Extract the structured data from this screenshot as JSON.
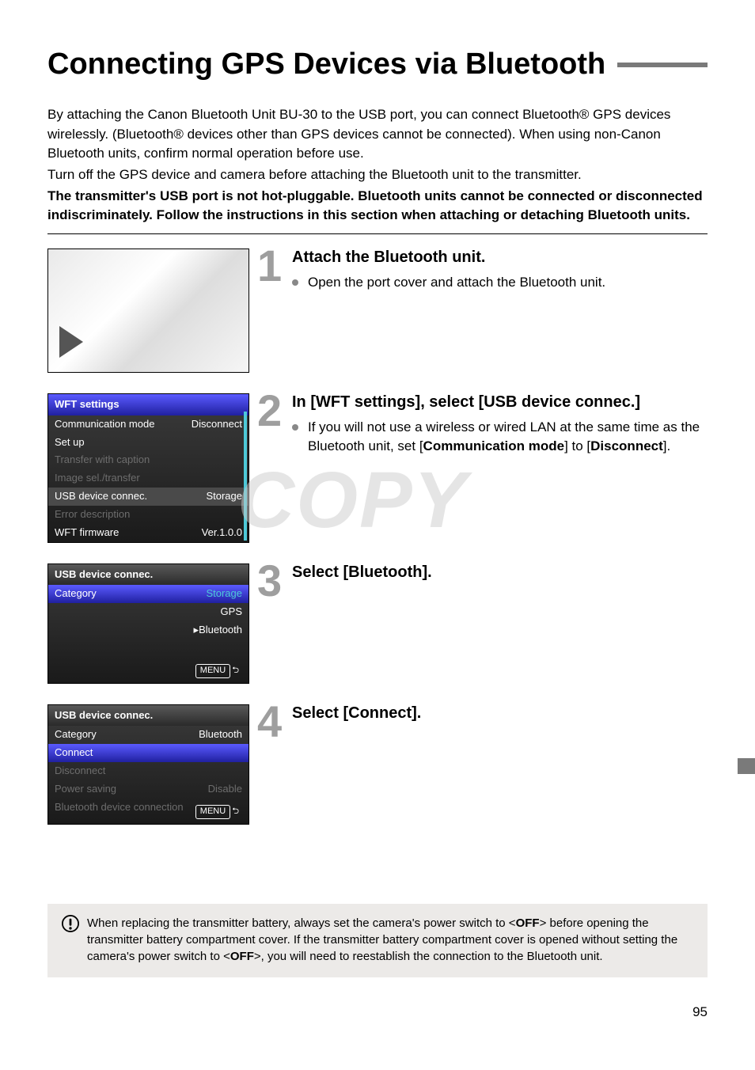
{
  "page": {
    "title": "Connecting GPS Devices via Bluetooth",
    "number": "95"
  },
  "intro": {
    "p1": "By attaching the Canon Bluetooth Unit BU-30 to the USB port, you can connect Bluetooth® GPS devices wirelessly. (Bluetooth® devices other than GPS devices cannot be connected). When using non-Canon Bluetooth units, confirm normal operation before use.",
    "p2": "Turn off the GPS device and camera before attaching the Bluetooth unit to the transmitter.",
    "p3_bold": "The transmitter's USB port is not hot-pluggable. Bluetooth units cannot be connected or disconnected indiscriminately. Follow the instructions in this section when attaching or detaching Bluetooth units."
  },
  "steps": [
    {
      "num": "1",
      "title": "Attach the Bluetooth unit.",
      "bullet": "Open the port cover and attach the Bluetooth unit."
    },
    {
      "num": "2",
      "title": "In [WFT settings], select [USB device connec.]",
      "bullet_pre": "If you will not use a wireless or wired LAN at the same time as the Bluetooth unit, set [",
      "bullet_b1": "Communication mode",
      "bullet_mid": "] to [",
      "bullet_b2": "Disconnect",
      "bullet_post": "]."
    },
    {
      "num": "3",
      "title": "Select [Bluetooth]."
    },
    {
      "num": "4",
      "title": "Select [Connect]."
    }
  ],
  "menu1": {
    "title": "WFT settings",
    "r1l": "Communication mode",
    "r1r": "Disconnect",
    "r2l": "Set up",
    "r3l": "Transfer with caption",
    "r4l": "Image sel./transfer",
    "r5l": "USB device connec.",
    "r5r": "Storage",
    "r6l": "Error description",
    "r7l": "WFT firmware",
    "r7r": "Ver.1.0.0"
  },
  "menu2": {
    "title": "USB device connec.",
    "catlabel": "Category",
    "opt1": "Storage",
    "opt2": "GPS",
    "opt3": "Bluetooth",
    "footer": "MENU"
  },
  "menu3": {
    "title": "USB device connec.",
    "r1l": "Category",
    "r1r": "Bluetooth",
    "r2l": "Connect",
    "r3l": "Disconnect",
    "r4l": "Power saving",
    "r4r": "Disable",
    "r5l": "Bluetooth device connection",
    "footer": "MENU"
  },
  "note": {
    "pre": "When replacing the transmitter battery, always set the camera's power switch to <",
    "off1": "OFF",
    "mid1": "> before opening the transmitter battery compartment cover. If the transmitter battery compartment cover is opened without setting the camera's power switch to <",
    "off2": "OFF",
    "post": ">, you will need to reestablish the connection to the Bluetooth unit."
  },
  "watermark": "COPY"
}
